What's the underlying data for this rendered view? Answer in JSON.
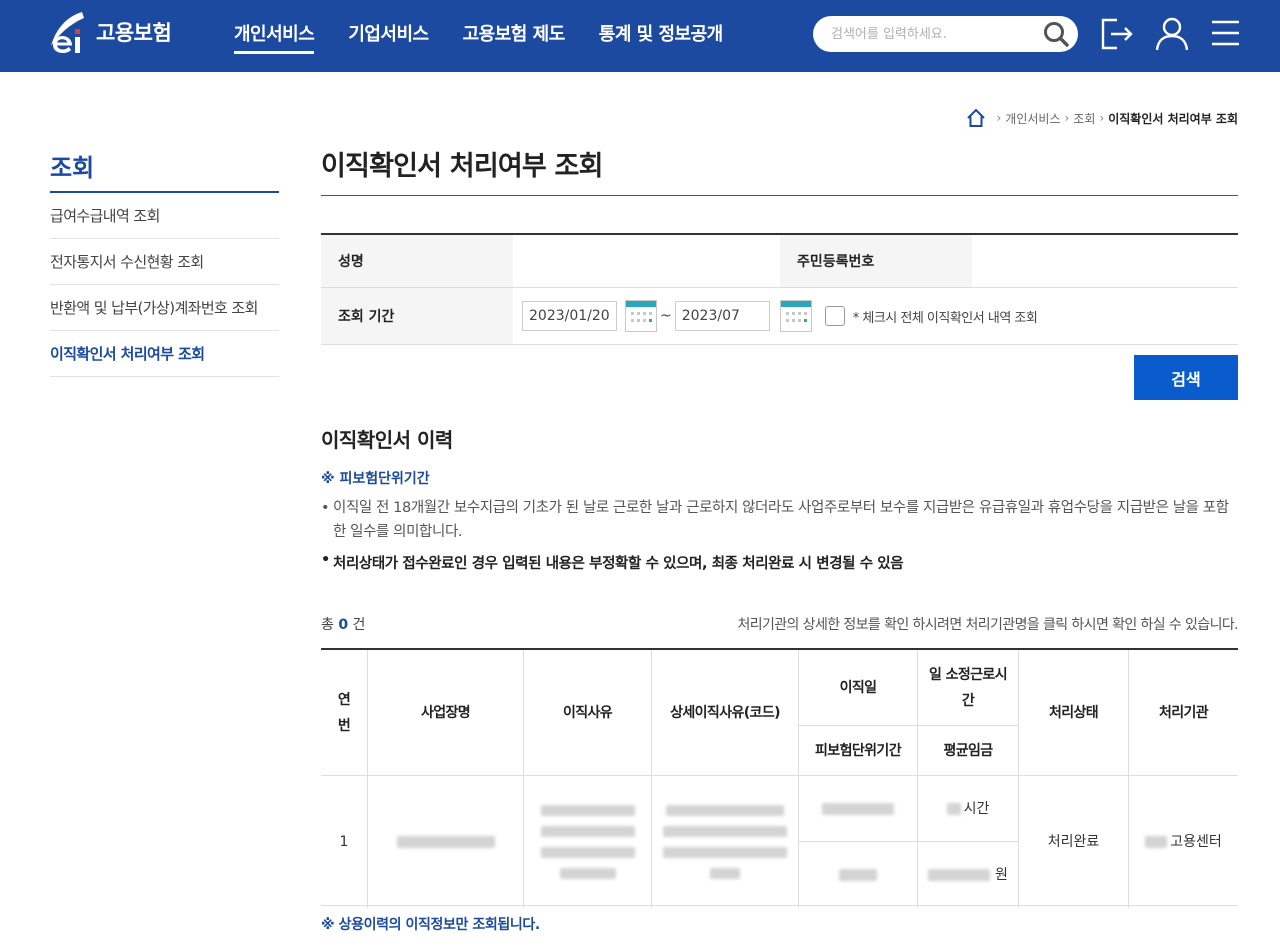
{
  "header": {
    "logo_text": "고용보험",
    "menu": [
      {
        "label": "개인서비스",
        "active": true
      },
      {
        "label": "기업서비스",
        "active": false
      },
      {
        "label": "고용보험 제도",
        "active": false
      },
      {
        "label": "통계 및 정보공개",
        "active": false
      }
    ],
    "search_placeholder": "검색어를 입력하세요.",
    "icons": [
      "search-icon",
      "logout-icon",
      "user-icon",
      "menu-icon"
    ],
    "brand_color": "#1c4aa0"
  },
  "breadcrumb": {
    "items": [
      "개인서비스",
      "조회"
    ],
    "current": "이직확인서 처리여부 조회"
  },
  "lnb": {
    "title": "조회",
    "items": [
      {
        "label": "급여수급내역 조회",
        "active": false
      },
      {
        "label": "전자통지서 수신현황 조회",
        "active": false
      },
      {
        "label": "반환액 및 납부(가상)계좌번호 조회",
        "active": false
      },
      {
        "label": "이직확인서 처리여부 조회",
        "active": true
      }
    ]
  },
  "main": {
    "title": "이직확인서 처리여부 조회",
    "form": {
      "name_label": "성명",
      "name_value": "",
      "rrn_label": "주민등록번호",
      "rrn_value": "",
      "period_label": "조회 기간",
      "date_from": "2023/01/20",
      "tilde": "~",
      "date_to": "2023/07",
      "check_label": "* 체크시 전체 이직확인서 내역 조회",
      "checked": false
    },
    "search_button": "검색",
    "history_title": "이직확인서 이력",
    "note_head": "※ 피보험단위기간",
    "note_bullet": "•",
    "note1": "이직일 전 18개월간 보수지급의 기초가 된 날로 근로한 날과 근로하지 않더라도 사업주로부터 보수를 지급받은 유급휴일과 휴업수당을 지급받은 날을 포함한 일수를 의미합니다.",
    "note2": "처리상태가 접수완료인 경우 입력된 내용은 부정확할 수 있으며, 최종 처리완료 시 변경될 수 있음",
    "total_prefix": "총",
    "total_count": "0",
    "total_suffix": "건",
    "info_right": "처리기관의 상세한 정보를 확인 하시려면 처리기관명을 클릭 하시면 확인 하실 수 있습니다.",
    "table": {
      "headers": {
        "no": "연\n번",
        "company": "사업장명",
        "reason": "이직사유",
        "detail_reason": "상세이직사유(코드)",
        "leave_date": "이직일",
        "insured_period": "피보험단위기간",
        "work_hours": "일 소정근로시\n간",
        "avg_wage": "평균임금",
        "status": "처리상태",
        "agency": "처리기관"
      },
      "rows": [
        {
          "no": "1",
          "hours_suffix": "시간",
          "wage_suffix": "원",
          "status": "처리완료",
          "agency_suffix": "고용센터"
        }
      ]
    },
    "bottom_note": "※ 상용이력의 이직정보만 조회됩니다."
  }
}
